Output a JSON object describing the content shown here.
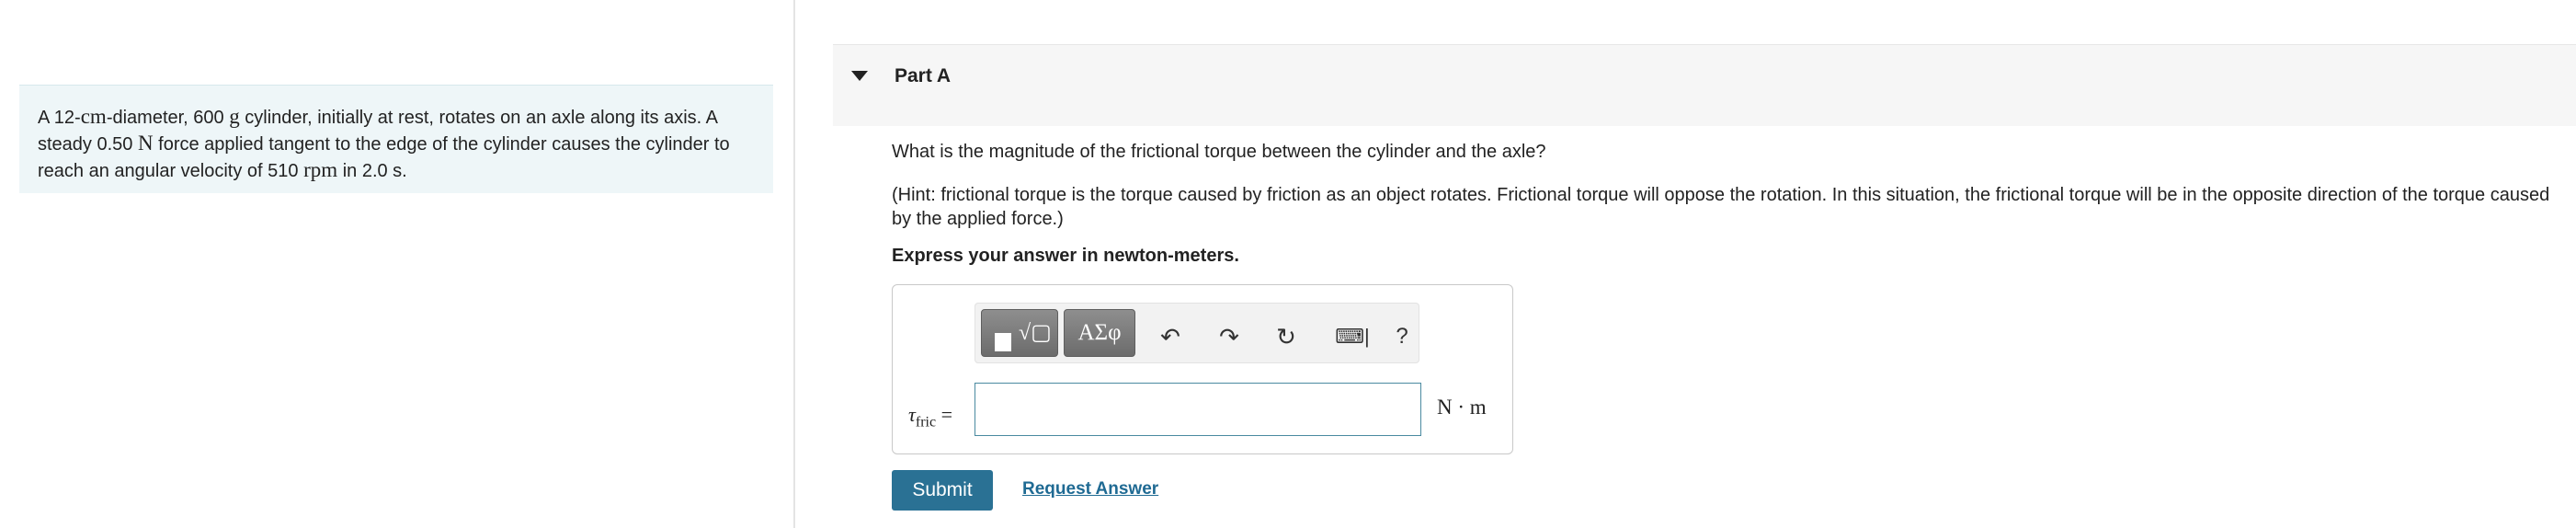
{
  "problem": {
    "text_1": "A 12-",
    "unit_cm": "cm",
    "text_2": "-diameter, 600 ",
    "unit_g": "g",
    "text_3": " cylinder, initially at rest, rotates on an axle along its axis. A steady 0.50 ",
    "unit_N": "N",
    "text_4": " force applied tangent to the edge of the cylinder causes the cylinder to reach an angular velocity of 510 ",
    "unit_rpm": "rpm",
    "text_5": " in 2.0 s."
  },
  "part": {
    "title": "Part A",
    "question": "What is the magnitude of the frictional torque between the cylinder and the axle?",
    "hint": "(Hint: frictional torque is the torque caused by friction as an object rotates. Frictional torque will oppose the rotation. In this situation, the frictional torque will be in the opposite direction of the torque caused by the applied force.)",
    "instruction": "Express your answer in newton-meters."
  },
  "toolbar": {
    "templates_sqrt": "√▢",
    "greek_label": "ΑΣφ",
    "undo_icon": "↶",
    "redo_icon": "↷",
    "reset_icon": "↻",
    "keyboard_icon": "⌨|",
    "help_label": "?"
  },
  "answer": {
    "var_symbol": "τ",
    "var_sub": "fric",
    "equals": "=",
    "value": "",
    "units": "N · m"
  },
  "actions": {
    "submit_label": "Submit",
    "request_label": "Request Answer"
  }
}
